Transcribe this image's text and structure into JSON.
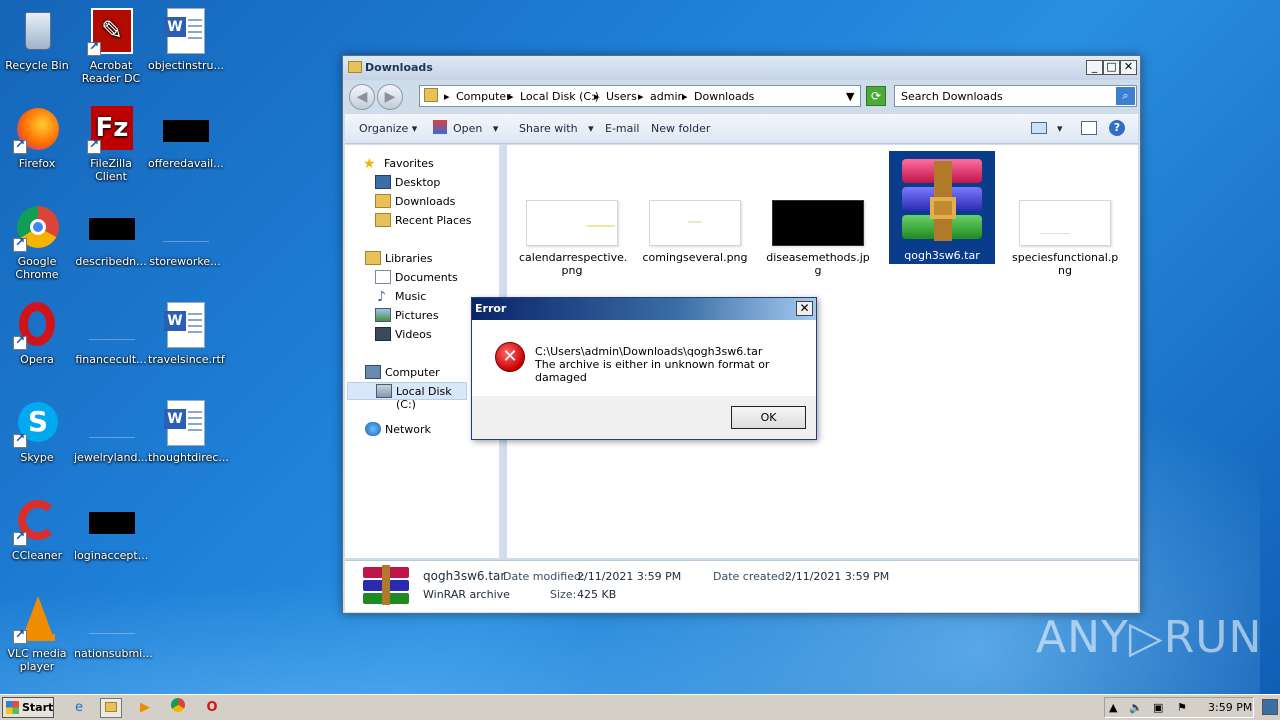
{
  "desktop": {
    "icons": [
      {
        "label": "Recycle Bin",
        "icon": "recycle-bin-icon"
      },
      {
        "label": "Acrobat Reader DC",
        "icon": "acrobat-icon"
      },
      {
        "label": "objectinstru...",
        "icon": "word-doc-icon"
      },
      {
        "label": "Firefox",
        "icon": "firefox-icon"
      },
      {
        "label": "FileZilla Client",
        "icon": "filezilla-icon"
      },
      {
        "label": "offeredavail...",
        "icon": "black-thumb-icon"
      },
      {
        "label": "Google Chrome",
        "icon": "chrome-icon"
      },
      {
        "label": "describedn...",
        "icon": "black-thumb-icon"
      },
      {
        "label": "storeworke...",
        "icon": "blank-thumb-icon"
      },
      {
        "label": "Opera",
        "icon": "opera-icon"
      },
      {
        "label": "financecult...",
        "icon": "blank-thumb-icon"
      },
      {
        "label": "travelsince.rtf",
        "icon": "word-doc-icon"
      },
      {
        "label": "Skype",
        "icon": "skype-icon"
      },
      {
        "label": "jewelryland....",
        "icon": "blank-thumb-icon"
      },
      {
        "label": "thoughtdirec...",
        "icon": "word-doc-icon"
      },
      {
        "label": "CCleaner",
        "icon": "ccleaner-icon"
      },
      {
        "label": "loginaccept...",
        "icon": "black-thumb-icon"
      },
      {
        "label": "VLC media player",
        "icon": "vlc-icon"
      },
      {
        "label": "nationsubmi...",
        "icon": "blank-thumb-icon"
      }
    ]
  },
  "explorer": {
    "title": "Downloads",
    "controls": {
      "minimize": "_",
      "maximize": "□",
      "close": "✕"
    },
    "breadcrumb": [
      "Computer",
      "Local Disk (C:)",
      "Users",
      "admin",
      "Downloads"
    ],
    "search_placeholder": "Search Downloads",
    "toolbar": {
      "organize": "Organize",
      "open": "Open",
      "share_with": "Share with",
      "email": "E-mail",
      "new_folder": "New folder"
    },
    "nav": {
      "favorites": "Favorites",
      "desktop": "Desktop",
      "downloads": "Downloads",
      "recent_places": "Recent Places",
      "libraries": "Libraries",
      "documents": "Documents",
      "music": "Music",
      "pictures": "Pictures",
      "videos": "Videos",
      "computer": "Computer",
      "local_disk": "Local Disk (C:)",
      "network": "Network"
    },
    "files": [
      {
        "name": "calendarrespective.png",
        "line1": "calendarrespective.",
        "line2": "png"
      },
      {
        "name": "comingseveral.png",
        "line1": "comingseveral.png",
        "line2": ""
      },
      {
        "name": "diseasemethods.jpg",
        "line1": "diseasemethods.jp",
        "line2": "g"
      },
      {
        "name": "qogh3sw6.tar",
        "line1": "qogh3sw6.tar",
        "line2": ""
      },
      {
        "name": "speciesfunctional.png",
        "line1": "speciesfunctional.p",
        "line2": "ng"
      }
    ],
    "details": {
      "name": "qogh3sw6.tar",
      "type": "WinRAR archive",
      "modified_label": "Date modified:",
      "modified": "2/11/2021 3:59 PM",
      "created_label": "Date created:",
      "created": "2/11/2021 3:59 PM",
      "size_label": "Size:",
      "size": "425 KB"
    }
  },
  "dialog": {
    "title": "Error",
    "close": "✕",
    "path": "C:\\Users\\admin\\Downloads\\qogh3sw6.tar",
    "message": "The archive is either in unknown format or damaged",
    "ok": "OK"
  },
  "taskbar": {
    "start": "Start",
    "clock": "3:59 PM"
  },
  "watermark": "ANY▷RUN",
  "colors": {
    "selection": "#0a3c8c",
    "error": "#c80000",
    "accent": "#3d7fd0"
  }
}
